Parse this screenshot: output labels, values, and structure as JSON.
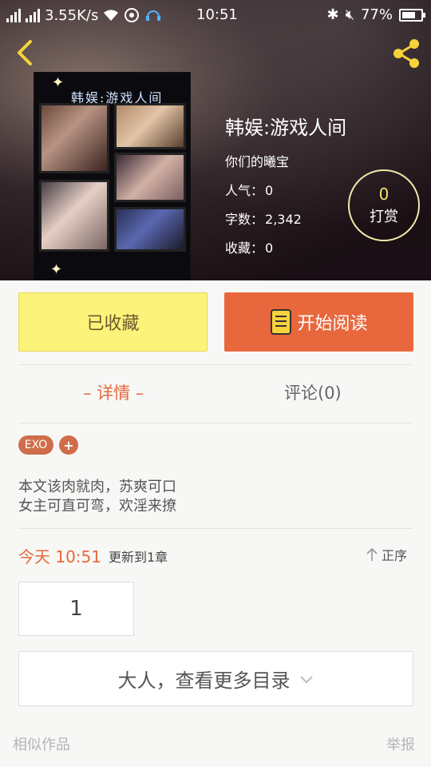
{
  "status_bar": {
    "net_speed": "3.55K/s",
    "time": "10:51",
    "battery": "77%",
    "battery_level": 0.77
  },
  "book": {
    "cover_text": "韩娱:游戏人间",
    "title": "韩娱:游戏人间",
    "author": "你们的曦宝",
    "popularity_label": "人气：",
    "popularity": "0",
    "words_label": "字数：",
    "words": "2,342",
    "favorites_label": "收藏：",
    "favorites": "0"
  },
  "reward": {
    "count": "0",
    "label": "打赏"
  },
  "actions": {
    "collected": "已收藏",
    "start_reading": "开始阅读"
  },
  "tabs": {
    "details": "– 详情 –",
    "comments": "评论(0)"
  },
  "tags": {
    "tag1": "EXO",
    "add": "+"
  },
  "description": {
    "line1": "本文该肉就肉，苏爽可口",
    "line2": "女主可直可弯，欢淫来撩"
  },
  "update": {
    "time": "今天 10:51",
    "text": "更新到1章",
    "sort_label": "正序"
  },
  "chapters": {
    "first": "1"
  },
  "catalog": {
    "more_label": "大人，查看更多目录"
  },
  "footer": {
    "similar": "相似作品",
    "report": "举报"
  },
  "colors": {
    "accent": "#e8673c",
    "collected_bg": "#fbf37a",
    "share_icon": "#f6d23c"
  }
}
